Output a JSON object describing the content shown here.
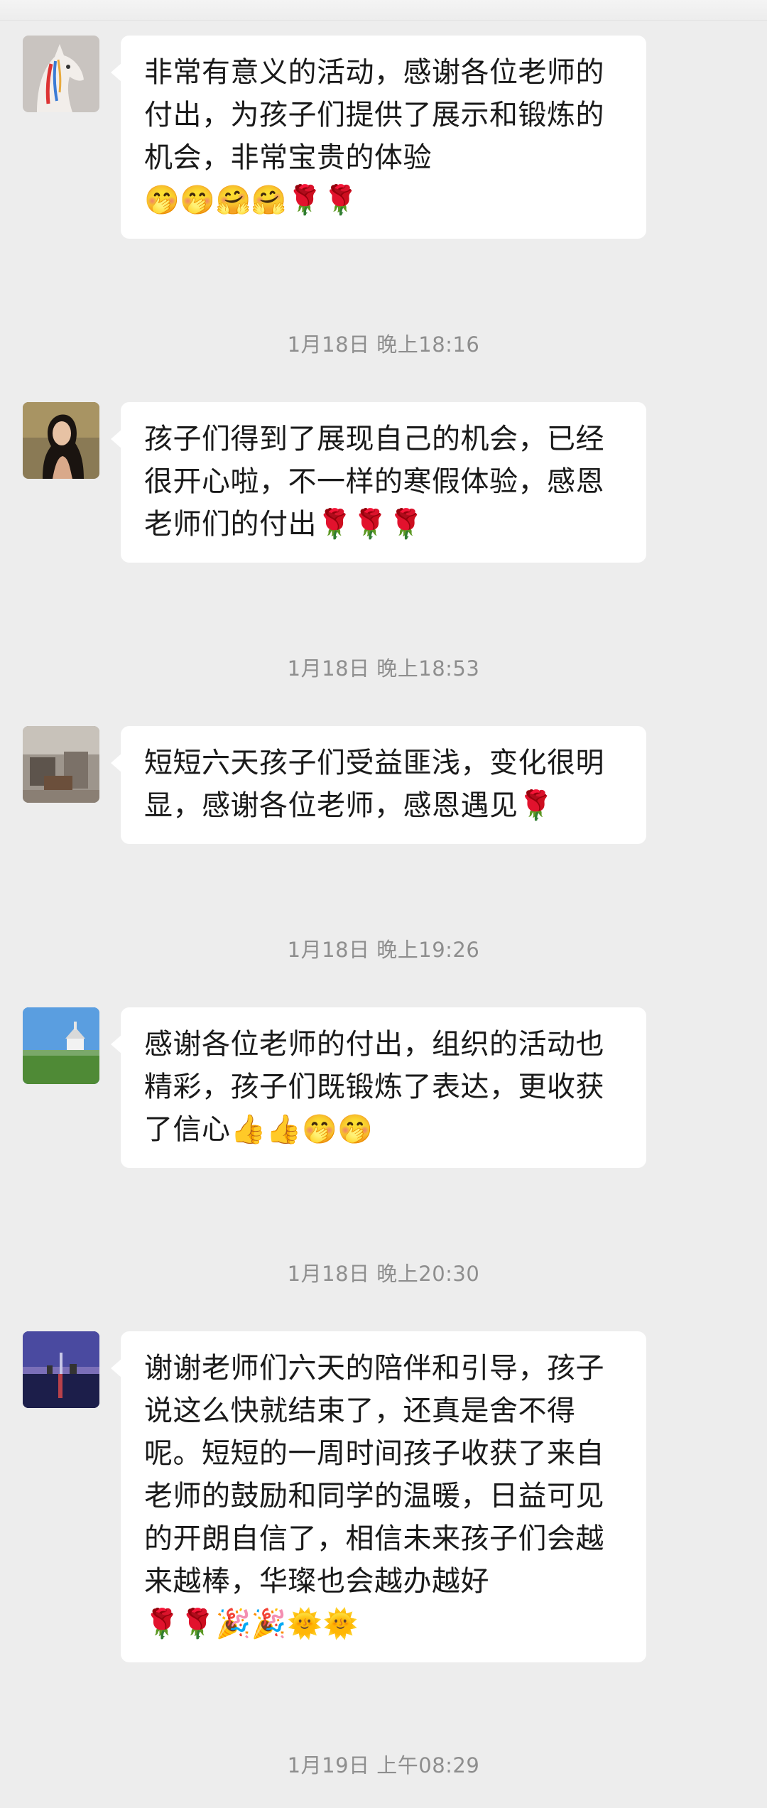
{
  "messages": [
    {
      "text": "非常有意义的活动，感谢各位老师的付出，为孩子们提供了展示和锻炼的机会，非常宝贵的体验",
      "emojis": "🤭🤭🤗🤗🌹🌹"
    },
    {
      "text": "孩子们得到了展现自己的机会，已经很开心啦，不一样的寒假体验，感恩老师们的付出",
      "emojis": "🌹🌹🌹"
    },
    {
      "text": "短短六天孩子们受益匪浅，变化很明显，感谢各位老师，感恩遇见",
      "emojis": "🌹"
    },
    {
      "text": "感谢各位老师的付出，组织的活动也精彩，孩子们既锻炼了表达，更收获了信心",
      "emojis": "👍👍🤭🤭"
    },
    {
      "text": "谢谢老师们六天的陪伴和引导，孩子说这么快就结束了，还真是舍不得呢。短短的一周时间孩子收获了来自老师的鼓励和同学的温暖，日益可见的开朗自信了，相信未来孩子们会越来越棒，华璨也会越办越好",
      "emojis": "🌹🌹🎉🎉🌞🌞"
    }
  ],
  "timestamps": [
    "1月18日 晚上18:16",
    "1月18日 晚上18:53",
    "1月18日 晚上19:26",
    "1月18日 晚上20:30",
    "1月19日 上午08:29"
  ]
}
